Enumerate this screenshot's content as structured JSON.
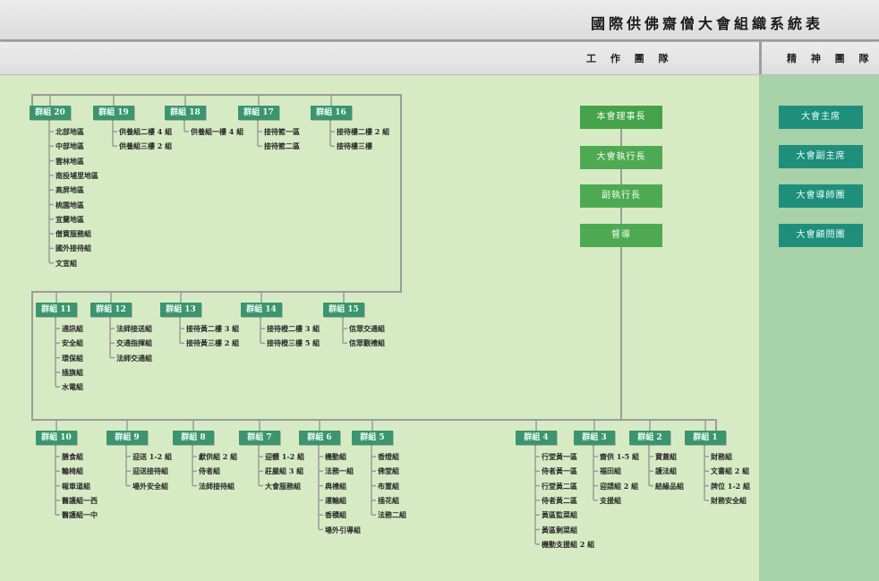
{
  "header": {
    "title": "國際供佛齋僧大會組織系統表",
    "section_work": "工 作 團 隊",
    "section_spirit": "精 神 團 隊"
  },
  "leadership": [
    "本會理事長",
    "大會執行長",
    "副執行長",
    "督導"
  ],
  "spirit_team": [
    "大會主席",
    "大會副主席",
    "大會導師團",
    "大會顧問團"
  ],
  "row1": [
    {
      "name": "groupset-20",
      "label": "群組 20",
      "items": [
        "北部地區",
        "中部地區",
        "雲林地區",
        "南投埔里地區",
        "高屏地區",
        "桃園地區",
        "宜蘭地區",
        "僧寶服務組",
        "國外接待組",
        "文宣組"
      ]
    },
    {
      "name": "groupset-19",
      "label": "群組 19",
      "items": [
        "供養組二樓 4 組",
        "供養組三樓 2 組"
      ]
    },
    {
      "name": "groupset-18",
      "label": "群組 18",
      "items": [
        "供養組一樓 4 組"
      ]
    },
    {
      "name": "groupset-17",
      "label": "群組 17",
      "items": [
        "接待籃一區",
        "接待籃二區"
      ]
    },
    {
      "name": "groupset-16",
      "label": "群組 16",
      "items": [
        "接待樓二樓 2 組",
        "接待樓三樓"
      ]
    }
  ],
  "row2": [
    {
      "name": "groupset-11",
      "label": "群組 11",
      "items": [
        "通訊組",
        "安全組",
        "環保組",
        "插旗組",
        "水電組"
      ]
    },
    {
      "name": "groupset-12",
      "label": "群組 12",
      "items": [
        "法師接送組",
        "交通指揮組",
        "法師交通組"
      ]
    },
    {
      "name": "groupset-13",
      "label": "群組 13",
      "items": [
        "接待黃二樓 3 組",
        "接待黃三樓 2 組"
      ]
    },
    {
      "name": "groupset-14",
      "label": "群組 14",
      "items": [
        "接待橙二樓 3 組",
        "接待橙三樓 5 組"
      ]
    },
    {
      "name": "groupset-15",
      "label": "群組 15",
      "items": [
        "信眾交通組",
        "信眾觀禮組"
      ]
    }
  ],
  "row3_left": [
    {
      "name": "groupset-10",
      "label": "群組 10",
      "items": [
        "膳食組",
        "輪椅組",
        "報車道組",
        "醫護組一西",
        "醫護組一中"
      ]
    },
    {
      "name": "groupset-9",
      "label": "群組 9",
      "items": [
        "迎送 1-2 組",
        "迎送接待組",
        "場外安全組"
      ]
    },
    {
      "name": "groupset-8",
      "label": "群組 8",
      "items": [
        "獻供組 2 組",
        "侍者組",
        "法師接待組"
      ]
    },
    {
      "name": "groupset-7",
      "label": "群組 7",
      "items": [
        "迎體 1-2 組",
        "莊嚴組 3 組",
        "大會服務組"
      ]
    },
    {
      "name": "groupset-6",
      "label": "群組 6",
      "items": [
        "機動組",
        "法務一組",
        "典禮組",
        "運輸組",
        "香積組",
        "場外引導組"
      ]
    },
    {
      "name": "groupset-5",
      "label": "群組 5",
      "items": [
        "香燈組",
        "佛堂組",
        "布置組",
        "插花組",
        "法務二組"
      ]
    }
  ],
  "row3_right": [
    {
      "name": "groupset-4",
      "label": "群組 4",
      "items": [
        "行堂黃一區",
        "侍者黃一區",
        "行堂黃二區",
        "侍者黃二區",
        "黃區監菜組",
        "黃區剩菜組",
        "機動支援組 2 組"
      ]
    },
    {
      "name": "groupset-3",
      "label": "群組 3",
      "items": [
        "齋供 1-5 組",
        "福田組",
        "迎請組 2 組",
        "支援組"
      ]
    },
    {
      "name": "groupset-2",
      "label": "群組 2",
      "items": [
        "寶蓋組",
        "護法組",
        "結緣品組"
      ]
    },
    {
      "name": "groupset-1",
      "label": "群組 1",
      "items": [
        "財務組",
        "文書組 2 組",
        "牌位 1-2 組",
        "財務安全組"
      ]
    }
  ],
  "colors": {
    "team_box": "#3c9470",
    "role_box": "#4eaa52",
    "spirit_box": "#1f8f7c",
    "background": "#d6ebc4",
    "spirit_column": "#a7d1a8"
  }
}
